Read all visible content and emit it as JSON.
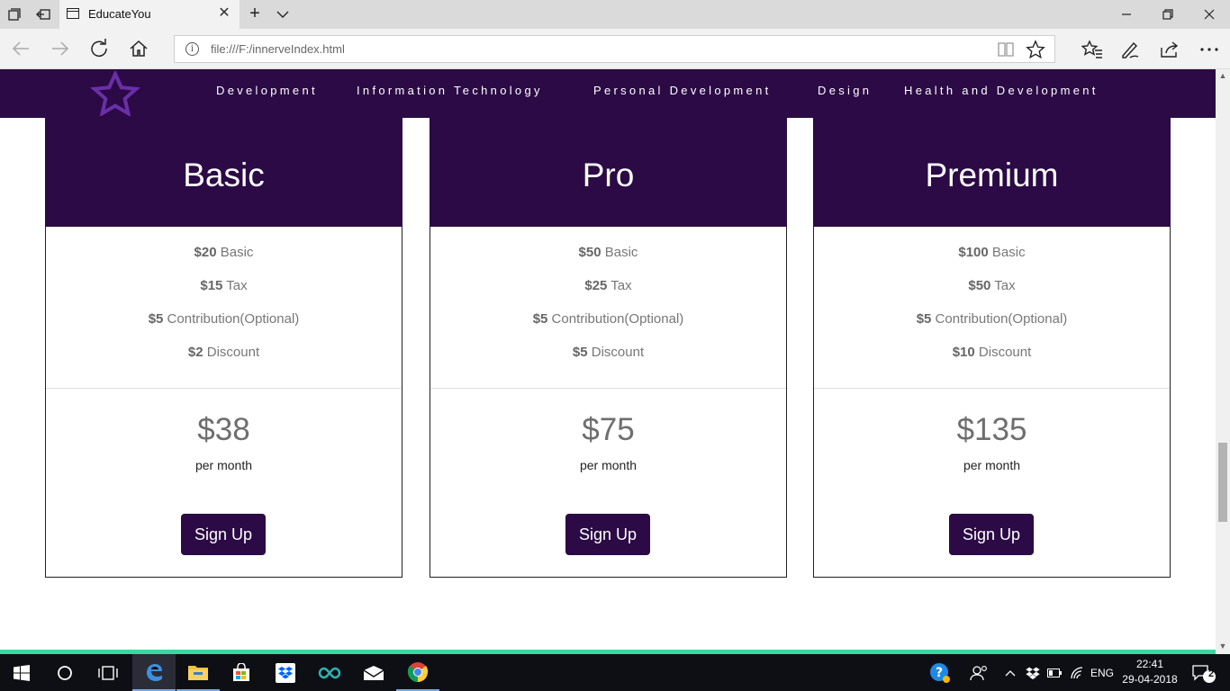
{
  "browser": {
    "tab_title": "EducateYou",
    "url": "file:///F:/innerveIndex.html"
  },
  "navbar": {
    "logo_icon": "star-outline-icon",
    "items": [
      {
        "label": "Development"
      },
      {
        "label": "Information Technology"
      },
      {
        "label": "Personal Development"
      },
      {
        "label": "Design"
      },
      {
        "label": "Health and Development"
      }
    ]
  },
  "plans": [
    {
      "name": "Basic",
      "features": [
        {
          "amount": "$20",
          "label": "Basic"
        },
        {
          "amount": "$15",
          "label": "Tax"
        },
        {
          "amount": "$5",
          "label": "Contribution(Optional)"
        },
        {
          "amount": "$2",
          "label": "Discount"
        }
      ],
      "price": "$38",
      "period": "per month",
      "button": "Sign Up"
    },
    {
      "name": "Pro",
      "features": [
        {
          "amount": "$50",
          "label": "Basic"
        },
        {
          "amount": "$25",
          "label": "Tax"
        },
        {
          "amount": "$5",
          "label": "Contribution(Optional)"
        },
        {
          "amount": "$5",
          "label": "Discount"
        }
      ],
      "price": "$75",
      "period": "per month",
      "button": "Sign Up"
    },
    {
      "name": "Premium",
      "features": [
        {
          "amount": "$100",
          "label": "Basic"
        },
        {
          "amount": "$50",
          "label": "Tax"
        },
        {
          "amount": "$5",
          "label": "Contribution(Optional)"
        },
        {
          "amount": "$10",
          "label": "Discount"
        }
      ],
      "price": "$135",
      "period": "per month",
      "button": "Sign Up"
    }
  ],
  "colors": {
    "brand": "#2b0a45",
    "accent_line": "#3dd6a0",
    "logo_star": "#6a2fa8"
  },
  "taskbar": {
    "apps": [
      "start-icon",
      "cortana-icon",
      "task-view-icon",
      "edge-icon",
      "file-explorer-icon",
      "store-icon",
      "dropbox-icon",
      "arduino-icon",
      "mail-icon",
      "chrome-icon"
    ],
    "language": "ENG",
    "time": "22:41",
    "date": "29-04-2018",
    "notification_count": "2"
  }
}
